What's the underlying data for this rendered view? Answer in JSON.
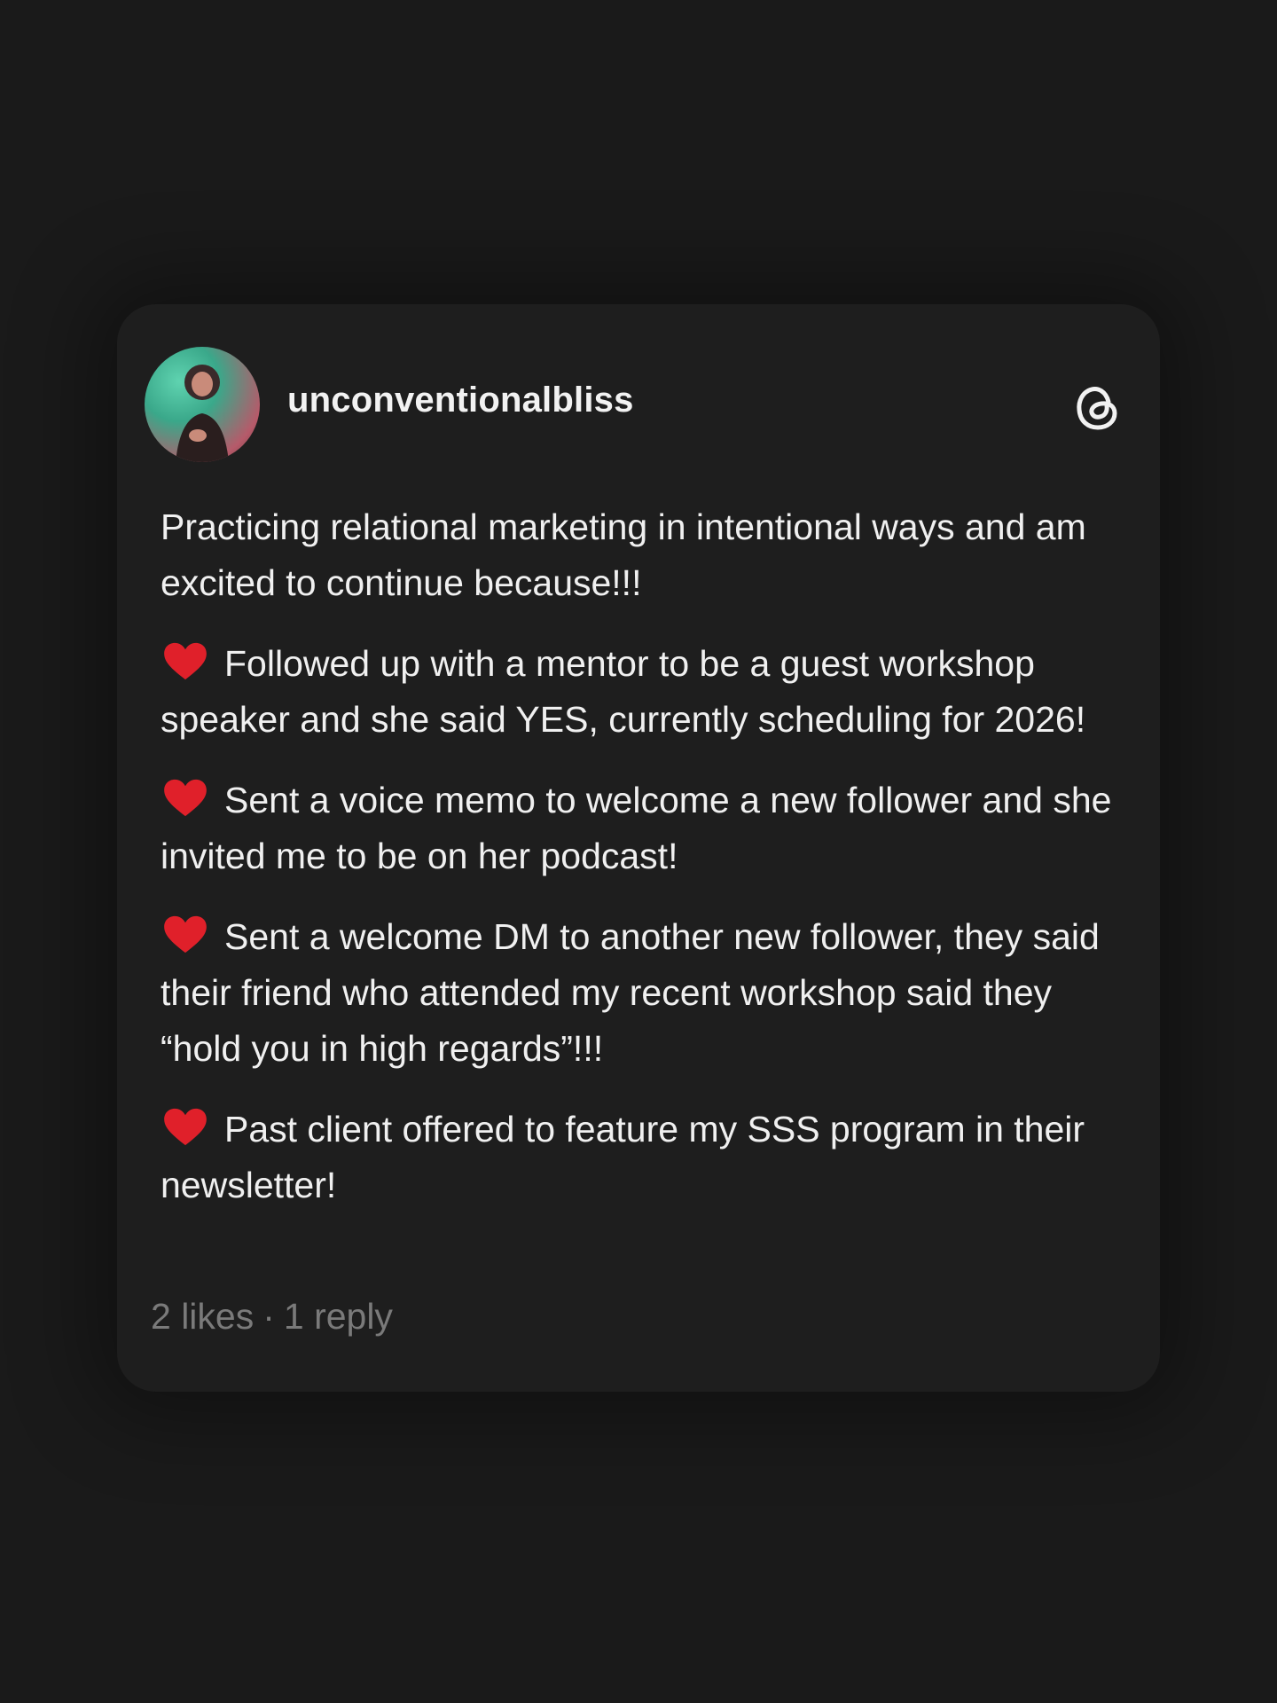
{
  "post": {
    "username": "unconventionalbliss",
    "avatar_icon": "profile-photo",
    "platform_icon": "threads-logo-icon",
    "intro": "Practicing relational marketing in intentional ways and am excited to continue because!!!",
    "items": [
      "Followed up with a mentor to be a guest workshop speaker and she said YES, currently scheduling for 2026!",
      "Sent a voice memo to welcome a new follower and she invited me to be on her podcast!",
      "Sent a welcome DM to another new follower, they said their friend who attended my recent workshop said they “hold you in high regards”!!!",
      "Past client offered to feature my SSS program in their newsletter!"
    ],
    "bullet_icon": "red-heart-icon",
    "likes": "2 likes",
    "separator": "·",
    "replies": "1 reply"
  },
  "colors": {
    "background": "#1a1a1a",
    "card": "#1e1e1e",
    "text": "#f0f0f0",
    "muted": "#7a7a7a",
    "heart": "#e0202a"
  }
}
